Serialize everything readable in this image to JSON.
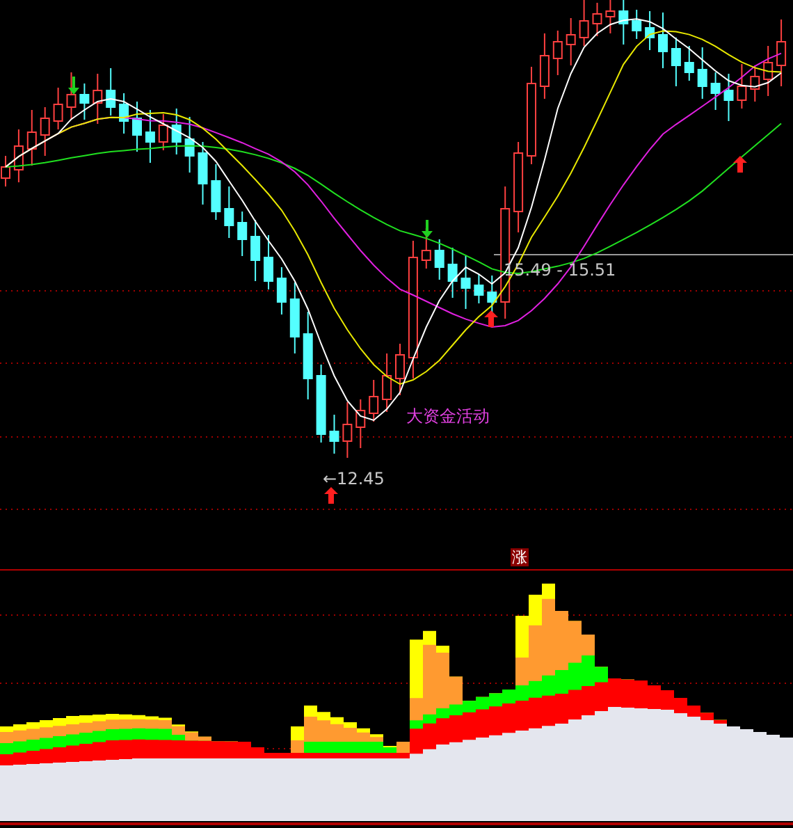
{
  "price_chart": {
    "range_label": "15.49 - 15.51",
    "annotation": "大资金活动",
    "low_label": "←12.45",
    "badge": "涨"
  }
}
